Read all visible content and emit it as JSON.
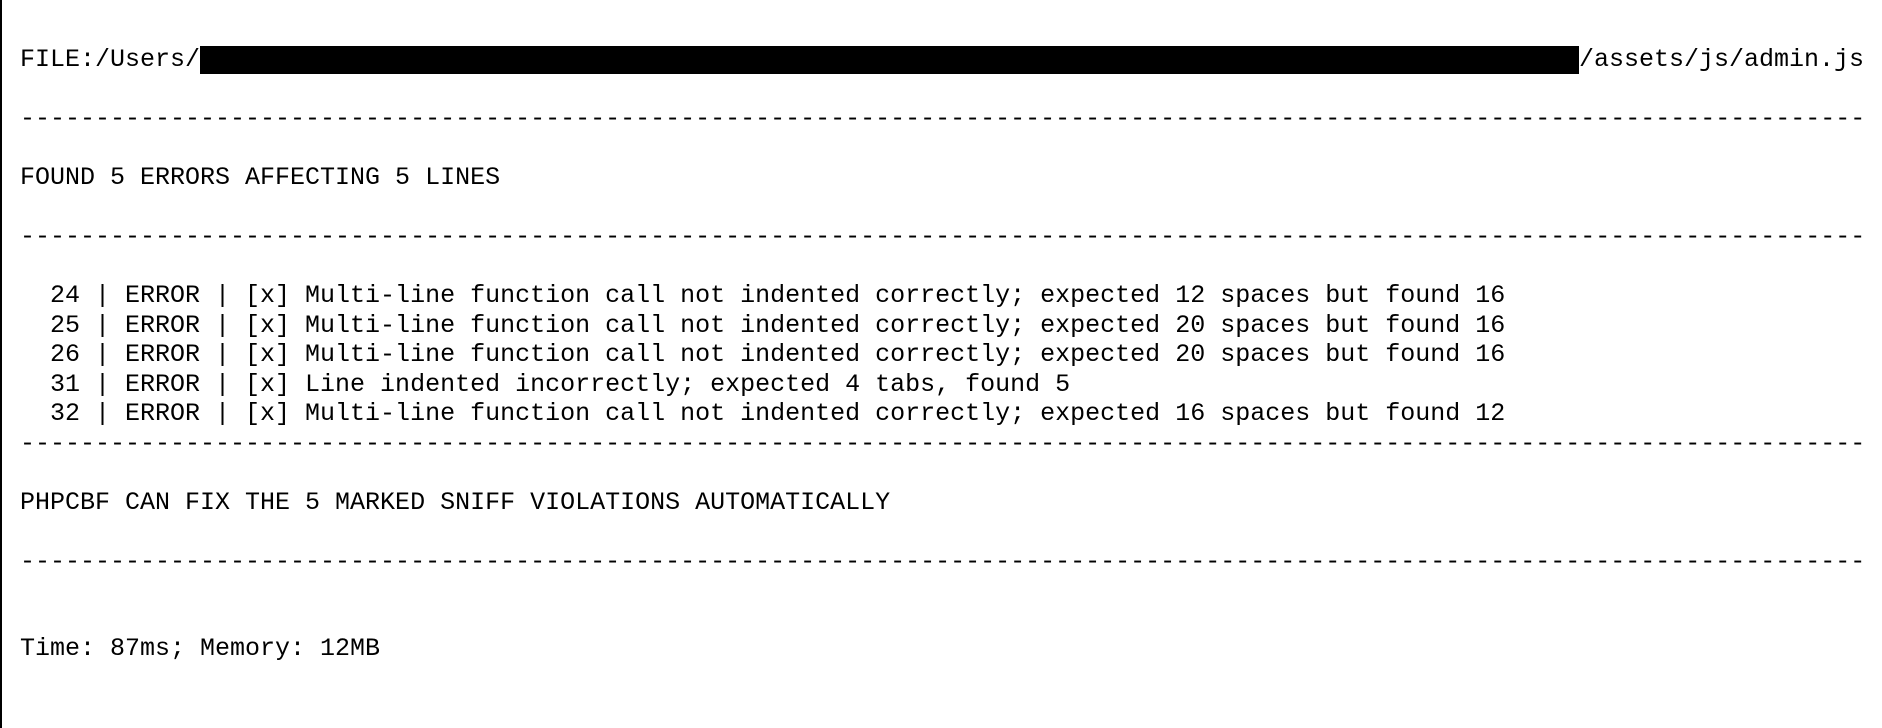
{
  "file": {
    "label": "FILE:",
    "path_prefix": "/Users/",
    "path_suffix": "/assets/js/admin.js"
  },
  "summary": "FOUND 5 ERRORS AFFECTING 5 LINES",
  "divider": "----------------------------------------------------------------------------------------------------------------------------",
  "errors": [
    {
      "line": "24",
      "type": "ERROR",
      "fixable": "[x]",
      "msg": "Multi-line function call not indented correctly; expected 12 spaces but found 16"
    },
    {
      "line": "25",
      "type": "ERROR",
      "fixable": "[x]",
      "msg": "Multi-line function call not indented correctly; expected 20 spaces but found 16"
    },
    {
      "line": "26",
      "type": "ERROR",
      "fixable": "[x]",
      "msg": "Multi-line function call not indented correctly; expected 20 spaces but found 16"
    },
    {
      "line": "31",
      "type": "ERROR",
      "fixable": "[x]",
      "msg": "Line indented incorrectly; expected 4 tabs, found 5"
    },
    {
      "line": "32",
      "type": "ERROR",
      "fixable": "[x]",
      "msg": "Multi-line function call not indented correctly; expected 16 spaces but found 12"
    }
  ],
  "fixer_note": "PHPCBF CAN FIX THE 5 MARKED SNIFF VIOLATIONS AUTOMATICALLY",
  "footer": "Time: 87ms; Memory: 12MB"
}
